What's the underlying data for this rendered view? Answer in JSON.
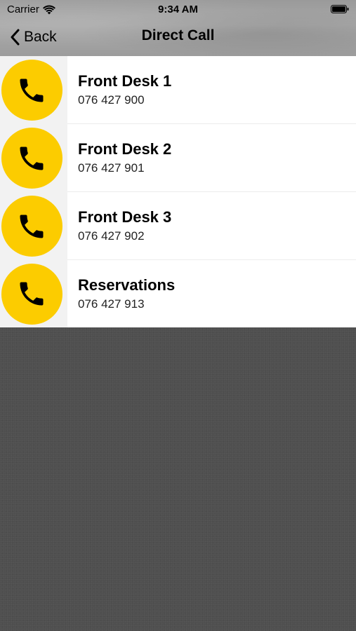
{
  "status_bar": {
    "carrier": "Carrier",
    "time": "9:34 AM"
  },
  "nav": {
    "back_label": "Back",
    "title": "Direct Call"
  },
  "contacts": [
    {
      "name": "Front Desk 1",
      "number": "076 427 900"
    },
    {
      "name": "Front Desk 2",
      "number": "076 427 901"
    },
    {
      "name": "Front Desk 3",
      "number": "076 427 902"
    },
    {
      "name": "Reservations",
      "number": "076 427 913"
    }
  ],
  "colors": {
    "accent": "#fccc00",
    "background": "#4f4f4f"
  },
  "icons": [
    "wifi-icon",
    "battery-icon",
    "chevron-left-icon",
    "phone-icon"
  ]
}
